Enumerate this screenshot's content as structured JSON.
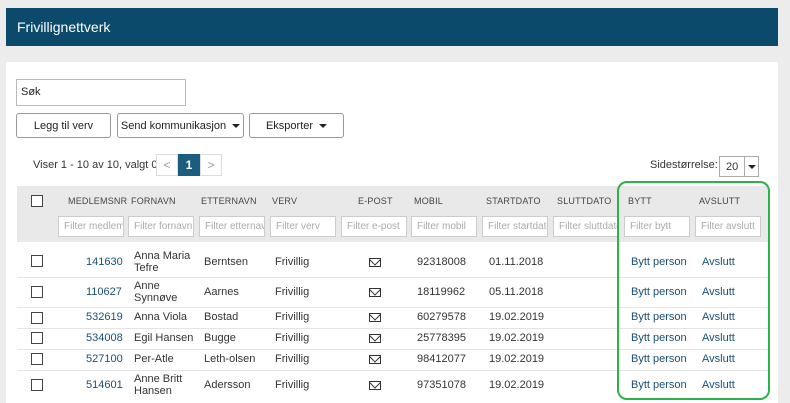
{
  "app": {
    "title": "Frivillignettverk"
  },
  "search": {
    "value": "Søk"
  },
  "toolbar": {
    "add_label": "Legg til verv",
    "send_label": "Send kommunikasjon",
    "export_label": "Eksporter"
  },
  "pager": {
    "info": "Viser 1 - 10 av 10, valgt 0",
    "prev": "<",
    "current": "1",
    "next": ">",
    "pagesize_label": "Sidestørrelse:",
    "pagesize_value": "20"
  },
  "columns": {
    "member": "MEDLEMSNR",
    "first": "FORNAVN",
    "last": "ETTERNAVN",
    "role": "VERV",
    "email": "E-POST",
    "mobile": "MOBIL",
    "start": "STARTDATO",
    "end": "SLUTTDATO",
    "swap": "BYTT",
    "close": "AVSLUTT"
  },
  "filters": {
    "member": "Filter medlemsnr",
    "first": "Filter fornavn",
    "last": "Filter etternavn",
    "role": "Filter verv",
    "email": "Filter e-post",
    "mobile": "Filter mobil",
    "start": "Filter startdato",
    "end": "Filter sluttdato",
    "swap": "Filter bytt",
    "close": "Filter avslutt"
  },
  "rows": [
    {
      "member": "141630",
      "first": "Anna Maria Tefre",
      "last": "Berntsen",
      "role": "Frivillig",
      "mobile": "92318008",
      "start": "01.11.2018",
      "swap": "Bytt person",
      "close": "Avslutt"
    },
    {
      "member": "110627",
      "first": "Anne Synnøve",
      "last": "Aarnes",
      "role": "Frivillig",
      "mobile": "18119962",
      "start": "05.11.2018",
      "swap": "Bytt person",
      "close": "Avslutt"
    },
    {
      "member": "532619",
      "first": "Anna Viola",
      "last": "Bostad",
      "role": "Frivillig",
      "mobile": "60279578",
      "start": "19.02.2019",
      "swap": "Bytt person",
      "close": "Avslutt"
    },
    {
      "member": "534008",
      "first": "Egil Hansen",
      "last": "Bugge",
      "role": "Frivillig",
      "mobile": "25778395",
      "start": "19.02.2019",
      "swap": "Bytt person",
      "close": "Avslutt"
    },
    {
      "member": "527100",
      "first": "Per-Atle",
      "last": "Leth-olsen",
      "role": "Frivillig",
      "mobile": "98412077",
      "start": "19.02.2019",
      "swap": "Bytt person",
      "close": "Avslutt"
    },
    {
      "member": "514601",
      "first": "Anne Britt Hansen",
      "last": "Adersson",
      "role": "Frivillig",
      "mobile": "97351078",
      "start": "19.02.2019",
      "swap": "Bytt person",
      "close": "Avslutt"
    }
  ],
  "colors": {
    "header": "#0b4a6b",
    "link": "#1a4f73",
    "highlight": "#2bb24c",
    "active_page": "#1b5d7f"
  }
}
